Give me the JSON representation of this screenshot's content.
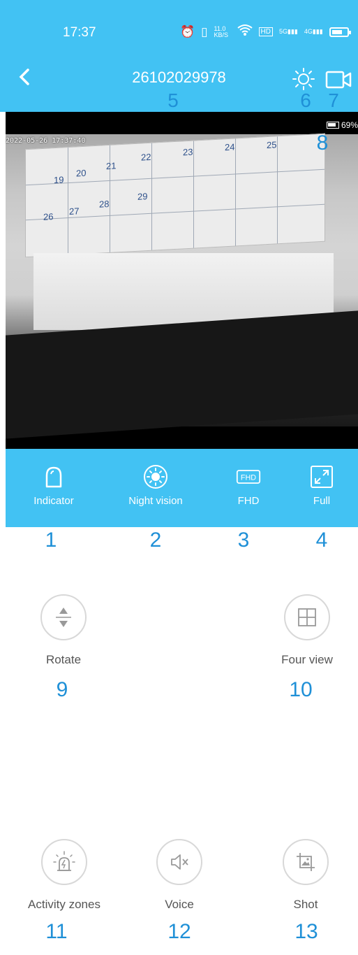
{
  "status_bar": {
    "time": "17:37",
    "net_speed": "11.0 KB/S",
    "hd_badge": "HD",
    "sim1": "5G",
    "sim2": "4G"
  },
  "header": {
    "title": "26102029978"
  },
  "video": {
    "timestamp": "2022-05-26 17:37:40",
    "battery_percent": "69%",
    "calendar_dates": [
      "22",
      "23",
      "24",
      "25",
      "19",
      "20",
      "21",
      "26",
      "27",
      "28",
      "29"
    ]
  },
  "toolbar": {
    "items": [
      {
        "label": "Indicator",
        "icon": "bell-shape-icon"
      },
      {
        "label": "Night vision",
        "icon": "sun-icon"
      },
      {
        "label": "FHD",
        "icon": "fhd-icon"
      },
      {
        "label": "Full",
        "icon": "fullscreen-icon"
      }
    ]
  },
  "controls": {
    "rotate": "Rotate",
    "four_view": "Four view",
    "activity_zones": "Activity zones",
    "voice": "Voice",
    "shot": "Shot"
  },
  "annotations": {
    "n1": "1",
    "n2": "2",
    "n3": "3",
    "n4": "4",
    "n5": "5",
    "n6": "6",
    "n7": "7",
    "n8": "8",
    "n9": "9",
    "n10": "10",
    "n11": "11",
    "n12": "12",
    "n13": "13"
  },
  "colors": {
    "accent": "#42c2f3",
    "annotation": "#1f90d7"
  }
}
